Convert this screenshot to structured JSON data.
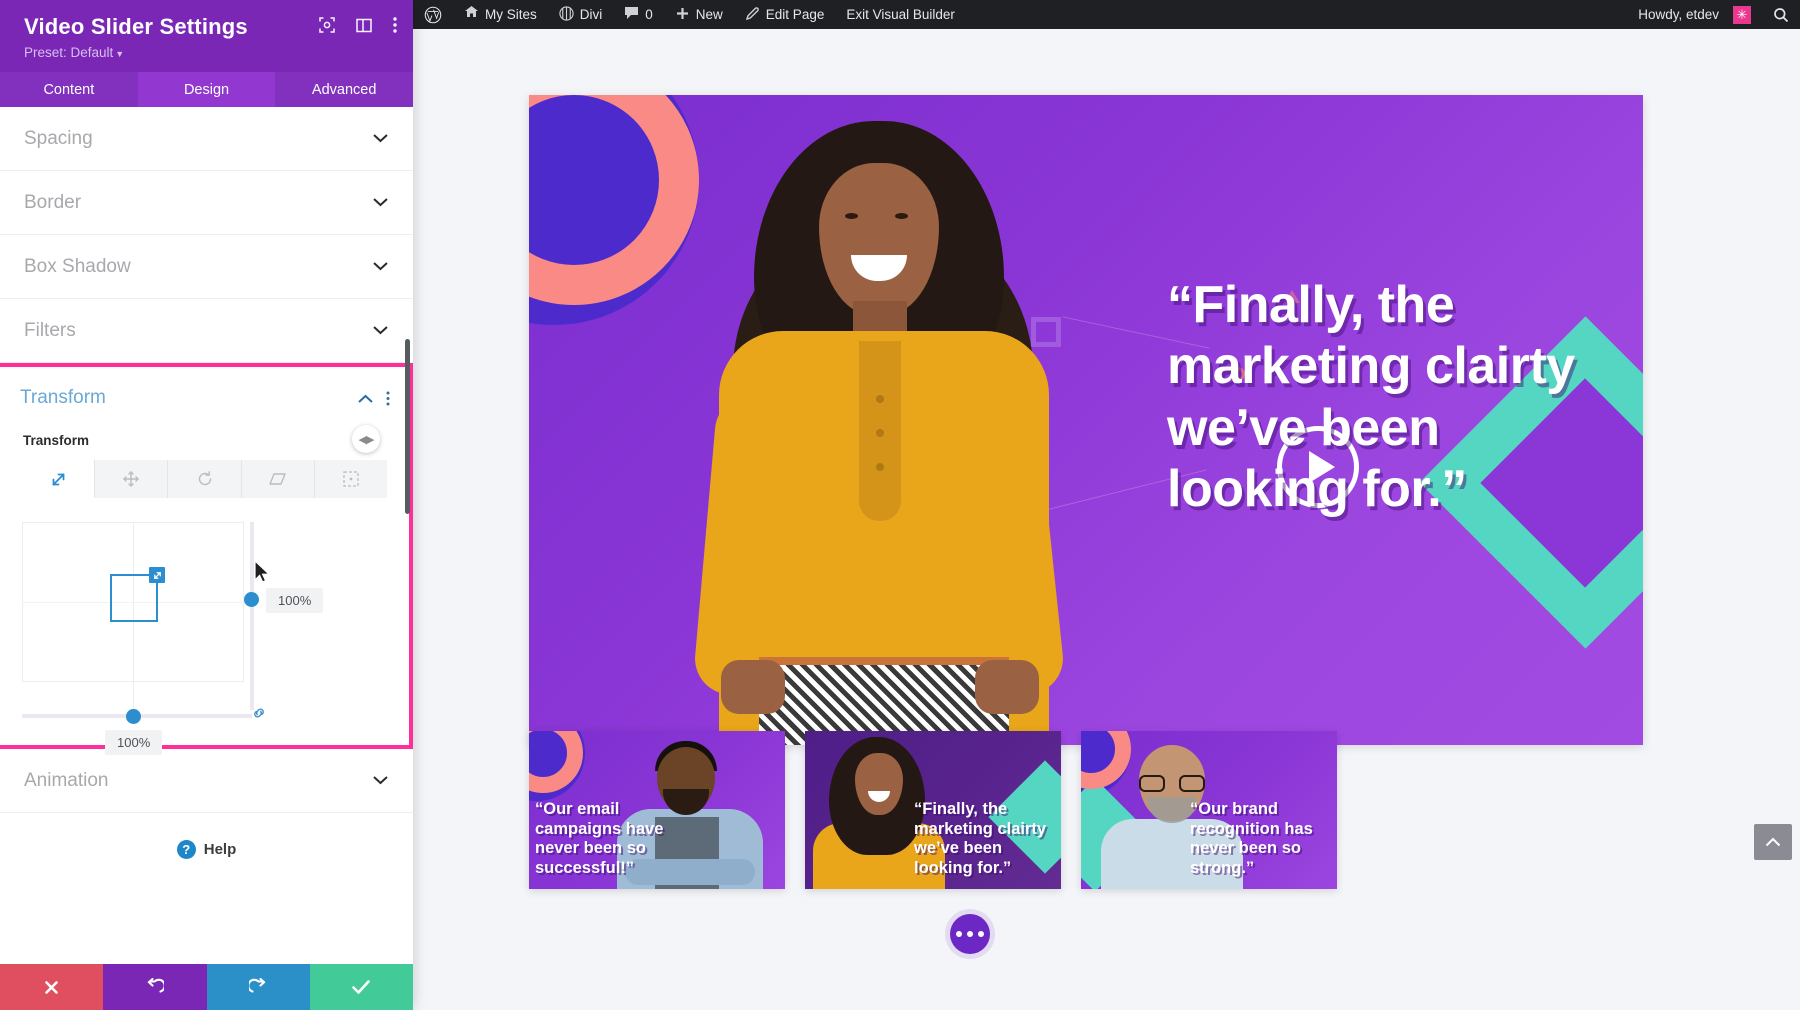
{
  "settings_panel": {
    "title": "Video Slider Settings",
    "preset_label": "Preset: Default",
    "header_icons": [
      {
        "name": "focus-icon"
      },
      {
        "name": "layout-columns-icon"
      },
      {
        "name": "vertical-dots-icon"
      }
    ],
    "tabs": [
      {
        "label": "Content",
        "active": false
      },
      {
        "label": "Design",
        "active": true
      },
      {
        "label": "Advanced",
        "active": false
      }
    ],
    "sections": [
      {
        "label": "Spacing",
        "expanded": false
      },
      {
        "label": "Border",
        "expanded": false
      },
      {
        "label": "Box Shadow",
        "expanded": false
      },
      {
        "label": "Filters",
        "expanded": false
      }
    ],
    "transform": {
      "section_label": "Transform",
      "field_label": "Transform",
      "highlighted": true,
      "highlight_color": "#FF2E9A",
      "accent_color": "#2C8ECF",
      "modes": [
        {
          "name": "scale-icon",
          "active": true
        },
        {
          "name": "translate-move-icon",
          "active": false
        },
        {
          "name": "rotate-icon",
          "active": false
        },
        {
          "name": "skew-icon",
          "active": false
        },
        {
          "name": "origin-icon",
          "active": false
        }
      ],
      "vertical_slider_value": "100%",
      "horizontal_slider_value": "100%",
      "link_axes_icon": "link-icon"
    },
    "animation_section": {
      "label": "Animation",
      "expanded": false
    },
    "help": {
      "label": "Help",
      "icon": "question-mark-icon"
    },
    "footer_buttons": [
      {
        "name": "cancel-button",
        "icon": "close-x-icon",
        "color": "#E04F5F"
      },
      {
        "name": "undo-button",
        "icon": "undo-arrow-icon",
        "color": "#7A27B6"
      },
      {
        "name": "redo-button",
        "icon": "redo-arrow-icon",
        "color": "#2C90C8"
      },
      {
        "name": "save-button",
        "icon": "checkmark-icon",
        "color": "#42CB98"
      }
    ]
  },
  "admin_bar": {
    "items": [
      {
        "label": "",
        "icon": "wordpress-logo-icon"
      },
      {
        "label": "My Sites",
        "icon": "sites-icon"
      },
      {
        "label": "Divi",
        "icon": "divi-logo-icon"
      },
      {
        "label": "0",
        "icon": "comment-bubble-icon"
      },
      {
        "label": "New",
        "icon": "plus-icon"
      },
      {
        "label": "Edit Page",
        "icon": "pencil-icon"
      },
      {
        "label": "Exit Visual Builder",
        "icon": ""
      }
    ],
    "howdy": "Howdy, etdev",
    "avatar_glyph": "✳",
    "search_icon": "search-icon"
  },
  "canvas": {
    "hero": {
      "quote": "“Finally, the marketing clairty we’ve been looking for.”",
      "play_button": "play-icon"
    },
    "thumbnails": [
      {
        "quote": "“Our email campaigns have never been so successful!”",
        "active": true
      },
      {
        "quote": "“Finally, the marketing clairty we’ve been looking for.”",
        "active": false
      },
      {
        "quote": "“Our brand recognition has never been so strong.”",
        "active": true
      }
    ],
    "more_button": "ellipsis-icon",
    "scroll_top_button": "chevron-up-icon"
  }
}
